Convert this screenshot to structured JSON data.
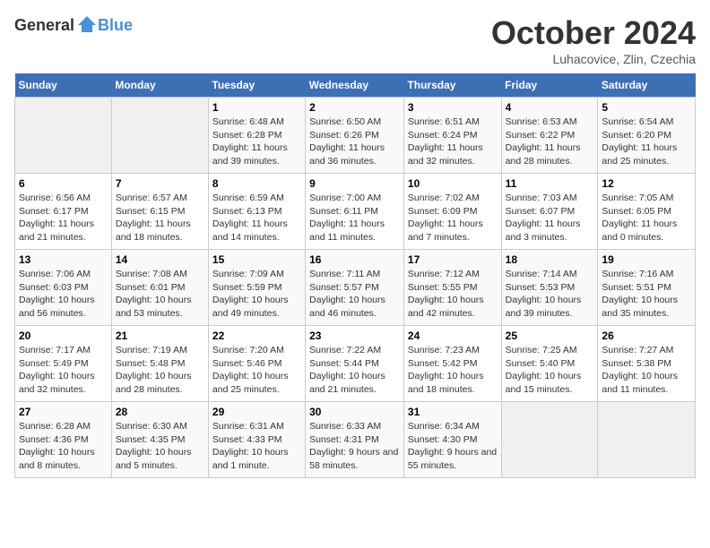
{
  "header": {
    "logo_general": "General",
    "logo_blue": "Blue",
    "month_title": "October 2024",
    "location": "Luhacovice, Zlin, Czechia"
  },
  "calendar": {
    "days_of_week": [
      "Sunday",
      "Monday",
      "Tuesday",
      "Wednesday",
      "Thursday",
      "Friday",
      "Saturday"
    ],
    "weeks": [
      [
        {
          "day": "",
          "info": ""
        },
        {
          "day": "",
          "info": ""
        },
        {
          "day": "1",
          "info": "Sunrise: 6:48 AM\nSunset: 6:28 PM\nDaylight: 11 hours and 39 minutes."
        },
        {
          "day": "2",
          "info": "Sunrise: 6:50 AM\nSunset: 6:26 PM\nDaylight: 11 hours and 36 minutes."
        },
        {
          "day": "3",
          "info": "Sunrise: 6:51 AM\nSunset: 6:24 PM\nDaylight: 11 hours and 32 minutes."
        },
        {
          "day": "4",
          "info": "Sunrise: 6:53 AM\nSunset: 6:22 PM\nDaylight: 11 hours and 28 minutes."
        },
        {
          "day": "5",
          "info": "Sunrise: 6:54 AM\nSunset: 6:20 PM\nDaylight: 11 hours and 25 minutes."
        }
      ],
      [
        {
          "day": "6",
          "info": "Sunrise: 6:56 AM\nSunset: 6:17 PM\nDaylight: 11 hours and 21 minutes."
        },
        {
          "day": "7",
          "info": "Sunrise: 6:57 AM\nSunset: 6:15 PM\nDaylight: 11 hours and 18 minutes."
        },
        {
          "day": "8",
          "info": "Sunrise: 6:59 AM\nSunset: 6:13 PM\nDaylight: 11 hours and 14 minutes."
        },
        {
          "day": "9",
          "info": "Sunrise: 7:00 AM\nSunset: 6:11 PM\nDaylight: 11 hours and 11 minutes."
        },
        {
          "day": "10",
          "info": "Sunrise: 7:02 AM\nSunset: 6:09 PM\nDaylight: 11 hours and 7 minutes."
        },
        {
          "day": "11",
          "info": "Sunrise: 7:03 AM\nSunset: 6:07 PM\nDaylight: 11 hours and 3 minutes."
        },
        {
          "day": "12",
          "info": "Sunrise: 7:05 AM\nSunset: 6:05 PM\nDaylight: 11 hours and 0 minutes."
        }
      ],
      [
        {
          "day": "13",
          "info": "Sunrise: 7:06 AM\nSunset: 6:03 PM\nDaylight: 10 hours and 56 minutes."
        },
        {
          "day": "14",
          "info": "Sunrise: 7:08 AM\nSunset: 6:01 PM\nDaylight: 10 hours and 53 minutes."
        },
        {
          "day": "15",
          "info": "Sunrise: 7:09 AM\nSunset: 5:59 PM\nDaylight: 10 hours and 49 minutes."
        },
        {
          "day": "16",
          "info": "Sunrise: 7:11 AM\nSunset: 5:57 PM\nDaylight: 10 hours and 46 minutes."
        },
        {
          "day": "17",
          "info": "Sunrise: 7:12 AM\nSunset: 5:55 PM\nDaylight: 10 hours and 42 minutes."
        },
        {
          "day": "18",
          "info": "Sunrise: 7:14 AM\nSunset: 5:53 PM\nDaylight: 10 hours and 39 minutes."
        },
        {
          "day": "19",
          "info": "Sunrise: 7:16 AM\nSunset: 5:51 PM\nDaylight: 10 hours and 35 minutes."
        }
      ],
      [
        {
          "day": "20",
          "info": "Sunrise: 7:17 AM\nSunset: 5:49 PM\nDaylight: 10 hours and 32 minutes."
        },
        {
          "day": "21",
          "info": "Sunrise: 7:19 AM\nSunset: 5:48 PM\nDaylight: 10 hours and 28 minutes."
        },
        {
          "day": "22",
          "info": "Sunrise: 7:20 AM\nSunset: 5:46 PM\nDaylight: 10 hours and 25 minutes."
        },
        {
          "day": "23",
          "info": "Sunrise: 7:22 AM\nSunset: 5:44 PM\nDaylight: 10 hours and 21 minutes."
        },
        {
          "day": "24",
          "info": "Sunrise: 7:23 AM\nSunset: 5:42 PM\nDaylight: 10 hours and 18 minutes."
        },
        {
          "day": "25",
          "info": "Sunrise: 7:25 AM\nSunset: 5:40 PM\nDaylight: 10 hours and 15 minutes."
        },
        {
          "day": "26",
          "info": "Sunrise: 7:27 AM\nSunset: 5:38 PM\nDaylight: 10 hours and 11 minutes."
        }
      ],
      [
        {
          "day": "27",
          "info": "Sunrise: 6:28 AM\nSunset: 4:36 PM\nDaylight: 10 hours and 8 minutes."
        },
        {
          "day": "28",
          "info": "Sunrise: 6:30 AM\nSunset: 4:35 PM\nDaylight: 10 hours and 5 minutes."
        },
        {
          "day": "29",
          "info": "Sunrise: 6:31 AM\nSunset: 4:33 PM\nDaylight: 10 hours and 1 minute."
        },
        {
          "day": "30",
          "info": "Sunrise: 6:33 AM\nSunset: 4:31 PM\nDaylight: 9 hours and 58 minutes."
        },
        {
          "day": "31",
          "info": "Sunrise: 6:34 AM\nSunset: 4:30 PM\nDaylight: 9 hours and 55 minutes."
        },
        {
          "day": "",
          "info": ""
        },
        {
          "day": "",
          "info": ""
        }
      ]
    ]
  }
}
